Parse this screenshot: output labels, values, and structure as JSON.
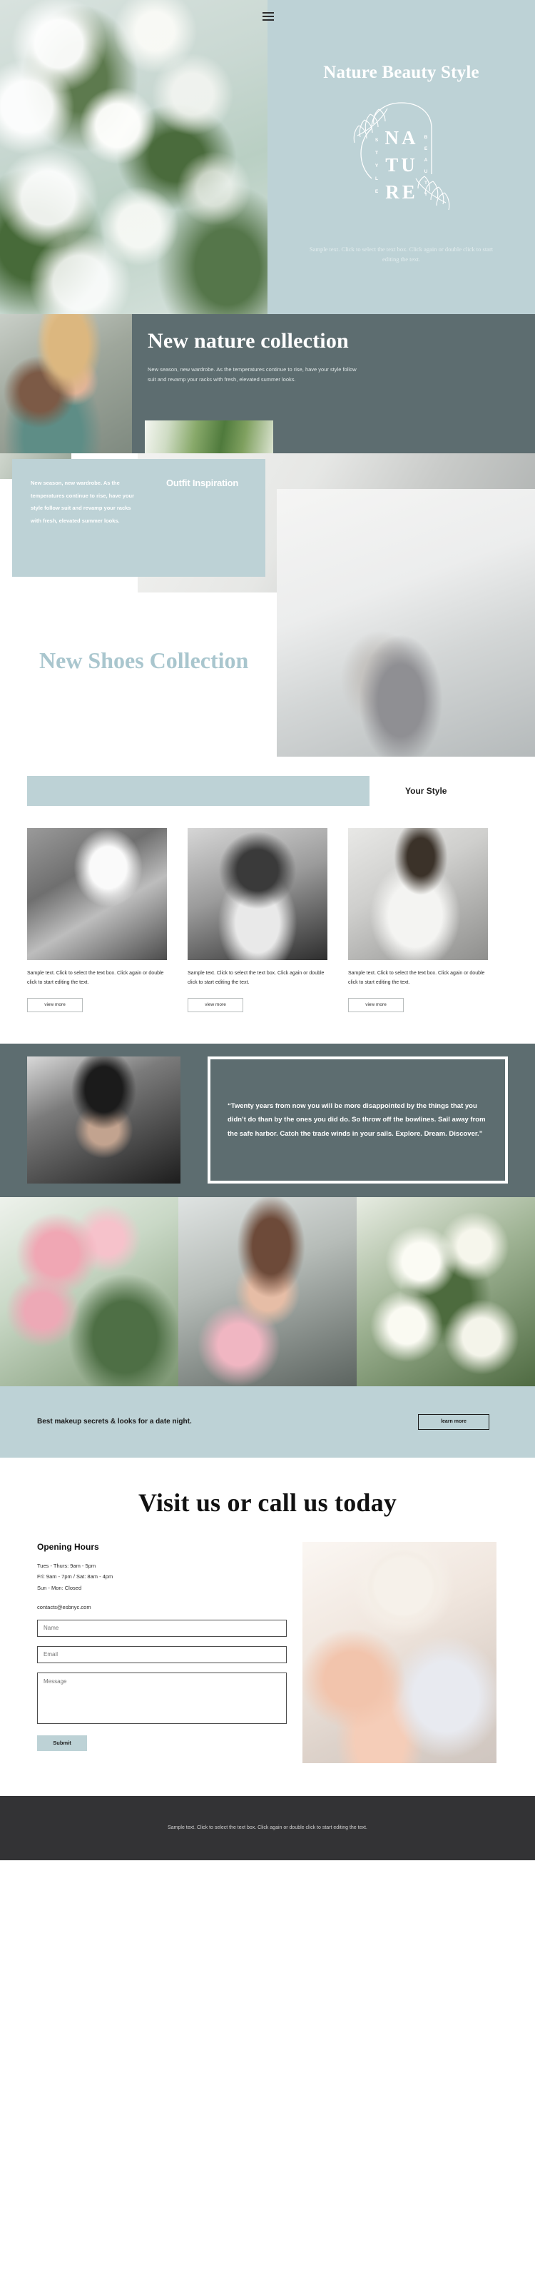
{
  "hero": {
    "menu_icon": "hamburger-menu-icon",
    "title": "Nature Beauty Style",
    "logo": {
      "main": "NATURE",
      "letters": [
        "N",
        "A",
        "T",
        "U",
        "R",
        "E"
      ],
      "left_word": "STYLE",
      "right_word": "BEAUTY"
    },
    "subtext": "Sample text. Click to select the text box. Click again or double click to start editing the text."
  },
  "collection": {
    "title": "New nature collection",
    "paragraph": "New season, new wardrobe. As the temperatures continue to rise, have your style follow suit and revamp your racks with fresh, elevated summer looks."
  },
  "outfit": {
    "title": "Outfit Inspiration",
    "paragraph": "New season, new wardrobe. As the temperatures continue to rise, have your style follow suit and revamp your racks with fresh, elevated summer looks."
  },
  "shoes": {
    "title": "New Shoes Collection"
  },
  "style": {
    "label": "Your Style",
    "cards": [
      {
        "text": "Sample text. Click to select the text box. Click again or double click to start editing the text.",
        "button": "view more"
      },
      {
        "text": "Sample text. Click to select the text box. Click again or double click to start editing the text.",
        "button": "view more"
      },
      {
        "text": "Sample text. Click to select the text box. Click again or double click to start editing the text.",
        "button": "view more"
      }
    ]
  },
  "quote": {
    "text": "“Twenty years from now you will be more disappointed by the things that you didn’t do than by the ones you did do. So throw off the bowlines. Sail away from the safe harbor. Catch the trade winds in your sails. Explore. Dream. Discover.”"
  },
  "makeup": {
    "heading": "Best makeup secrets & looks for a date night.",
    "button": "learn more"
  },
  "contact": {
    "title": "Visit us or call us today",
    "hours_title": "Opening Hours",
    "hours": "Tues - Thurs: 9am - 5pm\nFri: 9am - 7pm / Sat: 8am - 4pm\nSun - Mon: Closed",
    "email": "contacts@esbnyc.com",
    "name_placeholder": "Name",
    "email_placeholder": "Email",
    "message_placeholder": "Message",
    "submit_label": "Submit"
  },
  "footer": {
    "text": "Sample text. Click to select the text box. Click again or double click to start editing the text."
  },
  "colors": {
    "accent": "#bdd2d6",
    "dark_panel": "#5d6d70",
    "footer_bg": "#333335",
    "shoes_title": "#a9c6ce"
  }
}
